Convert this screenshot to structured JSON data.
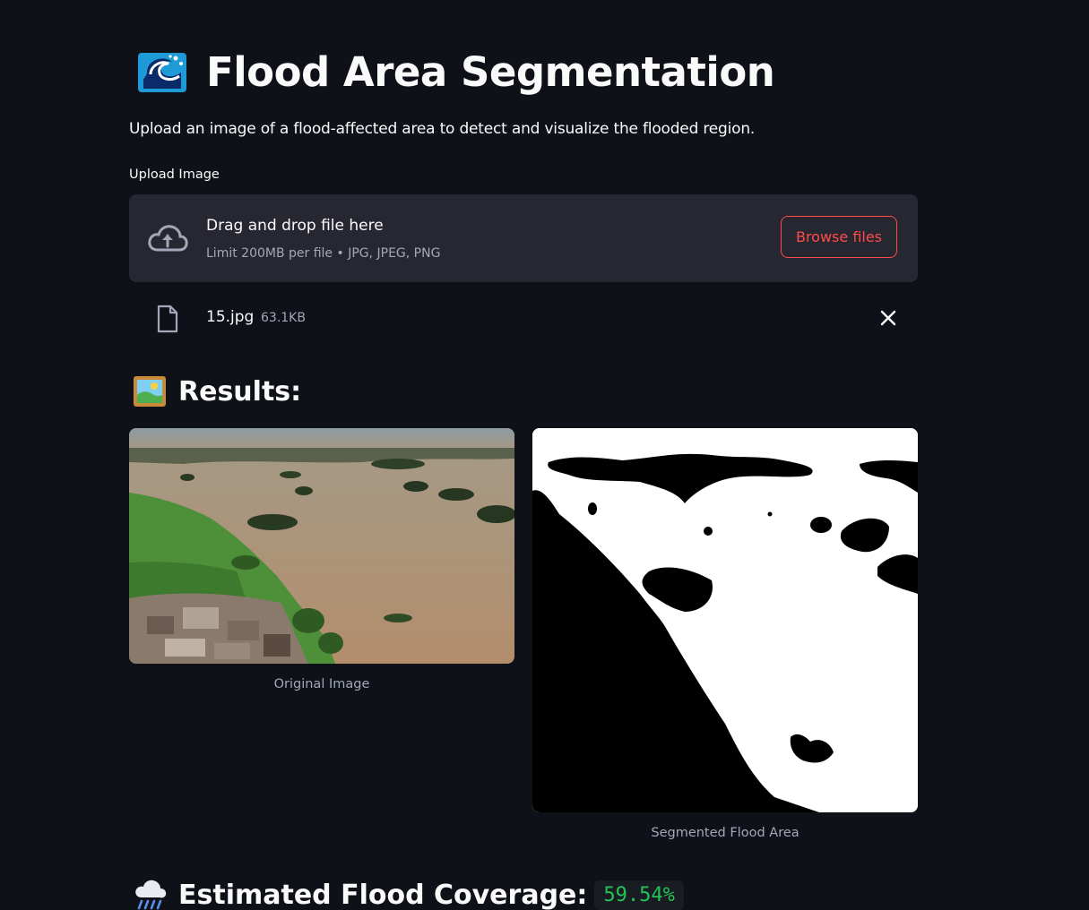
{
  "header": {
    "icon": "water-wave-icon",
    "title": "Flood Area Segmentation",
    "subtitle": "Upload an image of a flood-affected area to detect and visualize the flooded region."
  },
  "uploader": {
    "label": "Upload Image",
    "dropzone_title": "Drag and drop file here",
    "dropzone_limit": "Limit 200MB per file • JPG, JPEG, PNG",
    "browse_label": "Browse files",
    "icon": "cloud-upload-icon"
  },
  "uploaded_file": {
    "name": "15.jpg",
    "size": "63.1KB",
    "icon": "file-icon",
    "remove_icon": "close-icon"
  },
  "results": {
    "icon": "framed-picture-icon",
    "title": "Results:",
    "original_caption": "Original Image",
    "segmented_caption": "Segmented Flood Area"
  },
  "coverage": {
    "icon": "cloud-rain-icon",
    "title": "Estimated Flood Coverage:",
    "value": "59.54%",
    "value_color": "#21c354"
  },
  "colors": {
    "background": "#0e1117",
    "panel": "#262730",
    "accent": "#ff4b4b",
    "muted_text": "#a3a8b8"
  }
}
